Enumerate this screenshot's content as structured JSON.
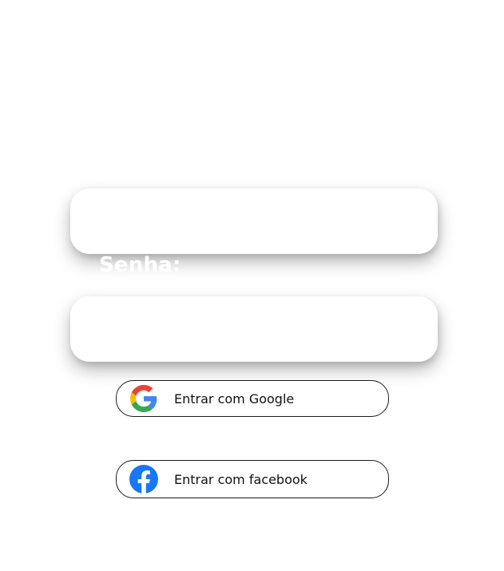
{
  "form": {
    "password_label": "Senha:",
    "email_value": "",
    "password_value": ""
  },
  "social": {
    "google_label": "Entrar com Google",
    "facebook_label": "Entrar com facebook"
  },
  "icons": {
    "google": "google-icon",
    "facebook": "facebook-icon"
  },
  "colors": {
    "background": "#ffffff",
    "button_border": "#1a1a1a",
    "facebook_blue": "#1877F2",
    "google_blue": "#4285F4",
    "google_red": "#EA4335",
    "google_yellow": "#FBBC05",
    "google_green": "#34A853"
  }
}
